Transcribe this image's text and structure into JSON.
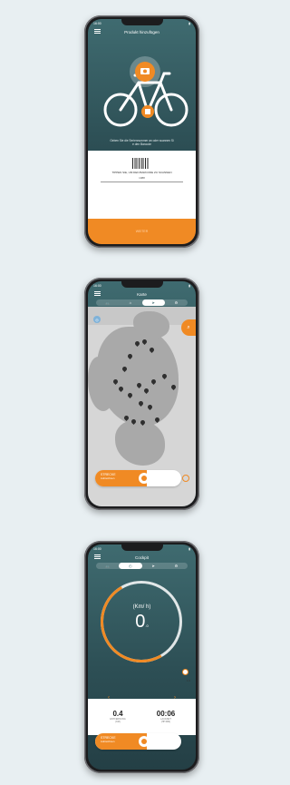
{
  "phone1": {
    "status_time": "16:00",
    "title": "Produkt hinzufügen",
    "hint_line1": "Geben Sie die Seriennummer an oder scannen Si",
    "hint_line2": "e den Barcode",
    "scan_label": "TIPPEN SIE, UM DEN BARCODE ZU SCANNEN",
    "code_value": "1088",
    "cta_label": "WEITER"
  },
  "phone2": {
    "status_time": "16:00",
    "title": "Karte",
    "tabs": [
      "🚲",
      "⌂",
      "➤",
      "⚙"
    ],
    "route_title": "STRECKE",
    "route_sub": "Aufzeichnen"
  },
  "phone3": {
    "status_time": "16:00",
    "title": "Cockpit",
    "tabs": [
      "🚲",
      "◴",
      "➤",
      "⚙"
    ],
    "unit": "(Km/ h)",
    "speed": "0",
    "speed_decimal": ".0",
    "scale_label": "1.0",
    "stat1_value": "0.4",
    "stat1_label1": "ENTFERNUNG",
    "stat1_label2": "(KM)",
    "stat2_value": "00:06",
    "stat2_label1": "LAUFZEIT",
    "stat2_label2": "(HH:MM)",
    "route_title": "STRECKE",
    "route_sub": "Aufzeichnen"
  },
  "colors": {
    "accent": "#f08a24",
    "teal": "#3f6b70",
    "background": "#e8eff2"
  }
}
